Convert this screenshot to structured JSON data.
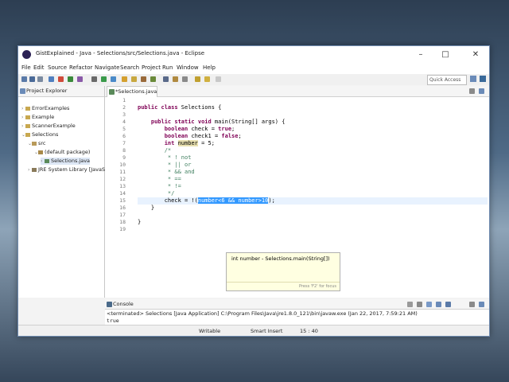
{
  "window": {
    "title": "GistExplained - Java - Selections/src/Selections.java - Eclipse"
  },
  "menu": [
    "File",
    "Edit",
    "Source",
    "Refactor",
    "Navigate",
    "Search",
    "Project",
    "Run",
    "Window",
    "Help"
  ],
  "toolbar": {
    "quick_access": "Quick Access"
  },
  "explorer": {
    "title": "Project Explorer",
    "items": [
      {
        "label": "ErrorExamples"
      },
      {
        "label": "Example"
      },
      {
        "label": "ScannerExample"
      },
      {
        "label": "Selections"
      },
      {
        "label": "src"
      },
      {
        "label": "(default package)"
      },
      {
        "label": "Selections.java"
      },
      {
        "label": "JRE System Library [JavaS"
      }
    ]
  },
  "editor": {
    "tab_label": "*Selections.java",
    "line_numbers": [
      "1",
      "2",
      "3",
      "4",
      "5",
      "6",
      "7",
      "8",
      "9",
      "10",
      "11",
      "12",
      "13",
      "14",
      "15",
      "16",
      "17",
      "18",
      "19"
    ],
    "hover": {
      "signature": "int number - Selections.main(String[])",
      "hint": "Press 'F2' for focus"
    }
  },
  "console": {
    "tab_label": "Console",
    "terminated": "<terminated> Selections [Java Application] C:\\Program Files\\Java\\jre1.8.0_121\\bin\\javaw.exe (Jan 22, 2017, 7:59:21 AM)",
    "output": "true"
  },
  "status": {
    "writable": "Writable",
    "insert": "Smart Insert",
    "position": "15 : 40"
  }
}
